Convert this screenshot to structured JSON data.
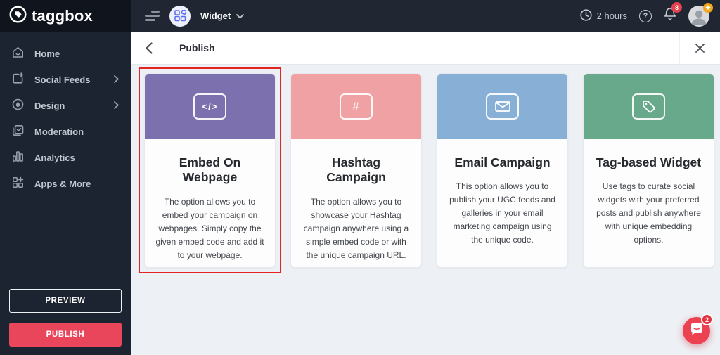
{
  "topbar": {
    "logo_text": "taggbox",
    "widget_label": "Widget",
    "session_time": "2 hours",
    "notification_count": "8",
    "help_glyph": "?",
    "icons": [
      "taggbox-logo-icon",
      "menu-icon",
      "widget-grid-icon",
      "chevron-down-icon",
      "clock-icon",
      "help-icon",
      "bell-icon",
      "avatar",
      "star-badge-icon"
    ]
  },
  "sidebar": {
    "items": [
      {
        "label": "Home",
        "icon": "home-icon",
        "has_submenu": false
      },
      {
        "label": "Social Feeds",
        "icon": "social-feeds-icon",
        "has_submenu": true
      },
      {
        "label": "Design",
        "icon": "design-icon",
        "has_submenu": true
      },
      {
        "label": "Moderation",
        "icon": "moderation-icon",
        "has_submenu": false
      },
      {
        "label": "Analytics",
        "icon": "analytics-icon",
        "has_submenu": false
      },
      {
        "label": "Apps & More",
        "icon": "apps-more-icon",
        "has_submenu": false
      }
    ],
    "preview_label": "PREVIEW",
    "publish_label": "PUBLISH",
    "publish_color": "#e9455b"
  },
  "panel": {
    "title": "Publish"
  },
  "cards": [
    {
      "title": "Embed On Webpage",
      "description": "The option allows you to embed your campaign on webpages. Simply copy the given embed code and add it to your webpage.",
      "header_color": "#7d70ae",
      "icon": "code-icon",
      "icon_glyph": "</>",
      "highlighted": true
    },
    {
      "title": "Hashtag Campaign",
      "description": "The option allows you to showcase your Hashtag campaign anywhere using a simple embed code or with the unique campaign URL.",
      "header_color": "#efa1a3",
      "icon": "hashtag-icon",
      "icon_glyph": "#",
      "highlighted": false
    },
    {
      "title": "Email Campaign",
      "description": "This option allows you to publish your UGC feeds and galleries in your email marketing campaign using the unique code.",
      "header_color": "#88b0d7",
      "icon": "envelope-icon",
      "icon_glyph": "",
      "highlighted": false
    },
    {
      "title": "Tag-based Widget",
      "description": "Use tags to curate social widgets with your preferred posts and publish anywhere with unique embedding options.",
      "header_color": "#68a98c",
      "icon": "tag-icon",
      "icon_glyph": "",
      "highlighted": false
    }
  ],
  "colors": {
    "annotation_red": "#e32222",
    "topbar_bg": "#202733",
    "sidebar_bg": "#1d2431",
    "main_bg": "#edf0f4",
    "chat_red": "#eb4150"
  },
  "chat": {
    "unread_count": "2"
  }
}
